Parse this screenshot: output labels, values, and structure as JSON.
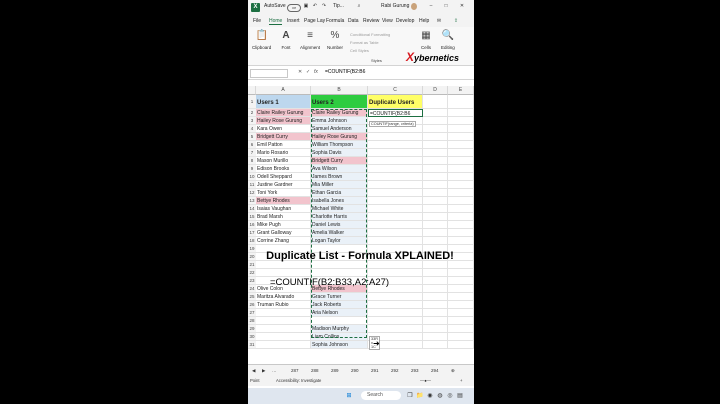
{
  "window": {
    "autosave_label": "AutoSave",
    "autosave_state": "Off",
    "doc_title": "Tip...",
    "user_name": "Rabi Gurung"
  },
  "menu": {
    "tabs": [
      "File",
      "Home",
      "Insert",
      "Page Lay",
      "Formula",
      "Data",
      "Review",
      "View",
      "Develop",
      "Help"
    ]
  },
  "ribbon": {
    "clipboard": "Clipboard",
    "font": "Font",
    "alignment": "Alignment",
    "number": "Number",
    "conditional_formatting": "Conditional Formatting",
    "format_as_table": "Format as Table",
    "cell_styles": "Cell Styles",
    "styles": "Styles",
    "cells": "Cells",
    "editing": "Editing"
  },
  "brand": {
    "x": "X",
    "rest": "ybernetics"
  },
  "formula_bar": {
    "formula": "=COUNTIF(B2:B6"
  },
  "columns": [
    "A",
    "B",
    "C",
    "D",
    "E"
  ],
  "headers": {
    "a": "Users 1",
    "b": "Users 2",
    "c": "Duplicate Users"
  },
  "rows": [
    {
      "n": "2",
      "a": "Claire Railey Gurung",
      "b": "Claire Railey Gurung",
      "c": "=COUNTIF(B2:B6"
    },
    {
      "n": "3",
      "a": "Hailey Rose Gurung",
      "b": "Emma Johnson",
      "c": ""
    },
    {
      "n": "4",
      "a": "Kara Owen",
      "b": "Samuel Anderson",
      "c": ""
    },
    {
      "n": "5",
      "a": "Bridgett Curry",
      "b": "Hailey Rose Gurung",
      "c": ""
    },
    {
      "n": "6",
      "a": "Emil Patton",
      "b": "William Thompson",
      "c": ""
    },
    {
      "n": "7",
      "a": "Mario Rosario",
      "b": "Sophia Davis",
      "c": ""
    },
    {
      "n": "8",
      "a": "Mason Murillo",
      "b": "Bridgett Curry",
      "c": ""
    },
    {
      "n": "9",
      "a": "Edison Brooks",
      "b": "Ava Wilson",
      "c": ""
    },
    {
      "n": "10",
      "a": "Odell Sheppard",
      "b": "James Brown",
      "c": ""
    },
    {
      "n": "11",
      "a": "Justine Gardner",
      "b": "Mia Miller",
      "c": ""
    },
    {
      "n": "12",
      "a": "Toni York",
      "b": "Ethan Garcia",
      "c": ""
    },
    {
      "n": "13",
      "a": "Bettye Rhodes",
      "b": "Isabella Jones",
      "c": ""
    },
    {
      "n": "14",
      "a": "Isaias Vaughan",
      "b": "Michael White",
      "c": ""
    },
    {
      "n": "15",
      "a": "Brad Marsh",
      "b": "Charlotte Harris",
      "c": ""
    },
    {
      "n": "16",
      "a": "Mike Pugh",
      "b": "Daniel Lewis",
      "c": ""
    },
    {
      "n": "17",
      "a": "Grant Galloway",
      "b": "Amelia Walker",
      "c": ""
    },
    {
      "n": "18",
      "a": "Corrine Zhang",
      "b": "Logan Taylor",
      "c": ""
    },
    {
      "n": "19",
      "a": "",
      "b": "",
      "c": ""
    },
    {
      "n": "20",
      "a": "",
      "b": "",
      "c": ""
    },
    {
      "n": "21",
      "a": "",
      "b": "",
      "c": ""
    },
    {
      "n": "22",
      "a": "",
      "b": "",
      "c": ""
    },
    {
      "n": "23",
      "a": "",
      "b": "",
      "c": ""
    },
    {
      "n": "24",
      "a": "Olive Colon",
      "b": "Bettye Rhodes",
      "c": ""
    },
    {
      "n": "25",
      "a": "Maritza Alvarado",
      "b": "Grace Turner",
      "c": ""
    },
    {
      "n": "26",
      "a": "Truman Rubio",
      "b": "Jack Roberts",
      "c": ""
    },
    {
      "n": "27",
      "a": "",
      "b": "Aria Nelson",
      "c": ""
    },
    {
      "n": "28",
      "a": "",
      "b": "",
      "c": ""
    },
    {
      "n": "29",
      "a": "",
      "b": "Madison Murphy",
      "c": ""
    },
    {
      "n": "30",
      "a": "",
      "b": "Liam Collins",
      "c": ""
    },
    {
      "n": "31",
      "a": "",
      "b": "Sophia Johnson",
      "c": ""
    }
  ],
  "tooltip": "COUNTIF(range, criteria)",
  "size_tip": "33R x 1C",
  "overlay": {
    "title": "Duplicate List - Formula XPLAINED!",
    "formula": "=COUNTIF(B2:B33,A2:A27)"
  },
  "sheet_tabs": [
    "287",
    "288",
    "289",
    "290",
    "291",
    "292",
    "293",
    "294"
  ],
  "status": {
    "mode": "Point",
    "accessibility": "Accessibility: Investigate"
  },
  "taskbar": {
    "search": "Search"
  }
}
